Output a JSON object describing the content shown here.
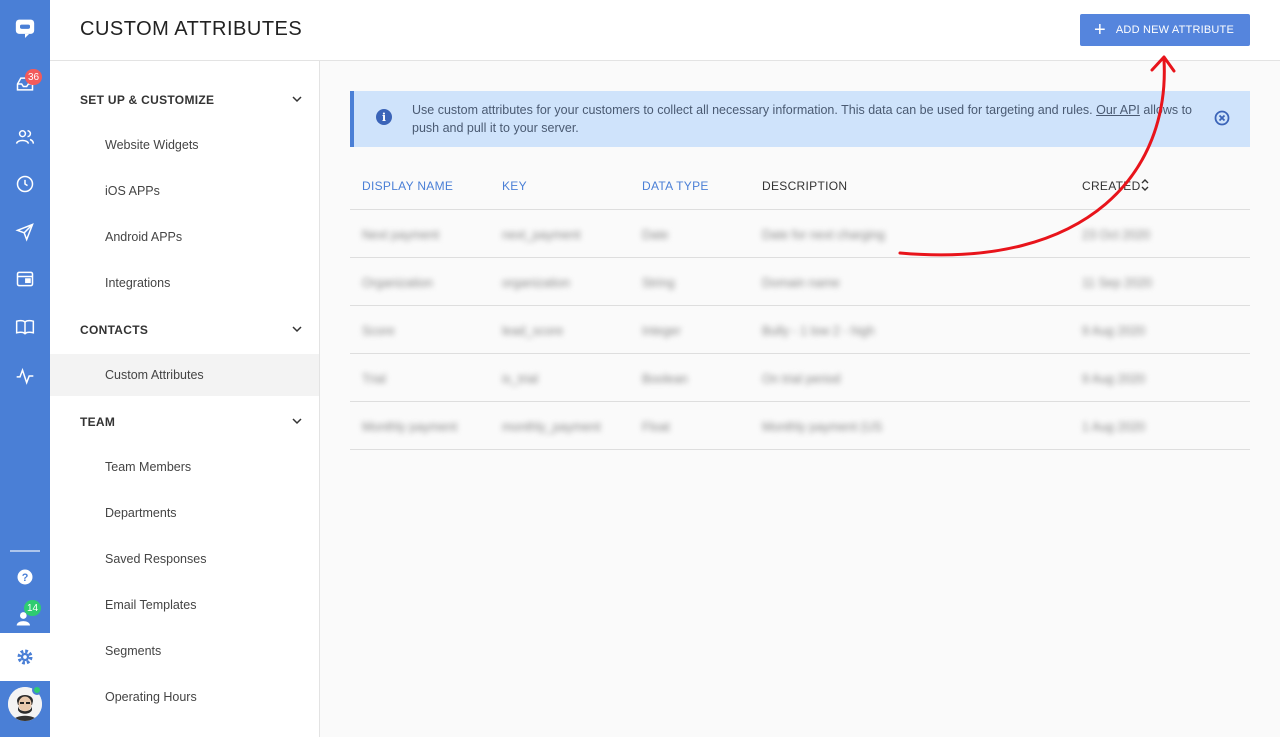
{
  "rail": {
    "chat_badge": "36",
    "team_badge": "14",
    "badge_color_red": "#f25b5b",
    "badge_color_green": "#2ecc71"
  },
  "header": {
    "title": "CUSTOM ATTRIBUTES",
    "add_button_label": "ADD NEW ATTRIBUTE"
  },
  "sidebar": {
    "sections": [
      {
        "title": "SET UP & CUSTOMIZE",
        "items": [
          "Website Widgets",
          "iOS APPs",
          "Android APPs",
          "Integrations"
        ]
      },
      {
        "title": "CONTACTS",
        "items": [
          "Custom Attributes"
        ]
      },
      {
        "title": "TEAM",
        "items": [
          "Team Members",
          "Departments",
          "Saved Responses",
          "Email Templates",
          "Segments",
          "Operating Hours"
        ]
      }
    ],
    "active_item": "Custom Attributes"
  },
  "info": {
    "text_before": "Use custom attributes for your customers to collect all necessary information. This data can be used for targeting and rules. ",
    "link": "Our API",
    "text_after": " allows to push and pull it to your server."
  },
  "table": {
    "headers": [
      "DISPLAY NAME",
      "KEY",
      "DATA TYPE",
      "DESCRIPTION",
      "CREATED"
    ],
    "rows": [
      [
        "Next payment",
        "next_payment",
        "Date",
        "Date for next charging",
        "23 Oct 2020"
      ],
      [
        "Organization",
        "organization",
        "String",
        "Domain name",
        "11 Sep 2020"
      ],
      [
        "Score",
        "lead_score",
        "Integer",
        "Bully - 1 low 2 - high",
        "9 Aug 2020"
      ],
      [
        "Trial",
        "is_trial",
        "Boolean",
        "On trial period",
        "9 Aug 2020"
      ],
      [
        "Monthly payment",
        "monthly_payment",
        "Float",
        "Monthly payment (US",
        "1 Aug 2020"
      ]
    ]
  },
  "colors": {
    "primary": "#4a7fd6",
    "button": "#5585dd",
    "info_bg": "#cfe3fb",
    "annotation": "#e8141b"
  }
}
